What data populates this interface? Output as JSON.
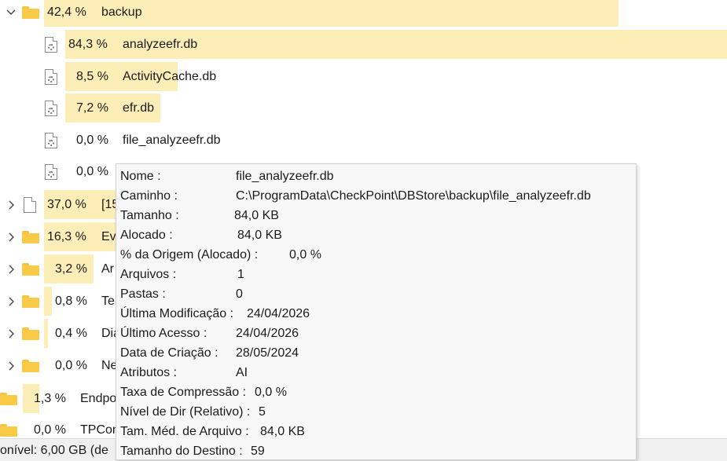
{
  "tree": {
    "backup": {
      "pct": "42,4 %",
      "name": "backup"
    },
    "files": [
      {
        "pct": "84,3 %",
        "name": "analyzeefr.db"
      },
      {
        "pct": "8,5 %",
        "name": "ActivityCache.db"
      },
      {
        "pct": "7,2 %",
        "name": "efr.db"
      },
      {
        "pct": "0,0 %",
        "name": "file_analyzeefr.db"
      },
      {
        "pct": "0,0 %",
        "name": ""
      }
    ],
    "siblings": [
      {
        "pct": "37,0 %",
        "name": "[15"
      },
      {
        "pct": "16,3 %",
        "name": "Ev"
      },
      {
        "pct": "3,2 %",
        "name": "Ar"
      },
      {
        "pct": "0,8 %",
        "name": "Ter"
      },
      {
        "pct": "0,4 %",
        "name": "Dia"
      },
      {
        "pct": "0,0 %",
        "name": "Ne"
      }
    ],
    "parents": [
      {
        "pct": "1,3 %",
        "name": "Endpo"
      },
      {
        "pct": "0,0 %",
        "name": "TPCon"
      }
    ]
  },
  "status": {
    "text": "onível: 6,00 GB  (de"
  },
  "tooltip": {
    "rows": [
      {
        "label": "Nome :",
        "value": "file_analyzeefr.db"
      },
      {
        "label": "Caminho :",
        "value": "C:\\ProgramData\\CheckPoint\\DBStore\\backup\\file_analyzeefr.db"
      },
      {
        "label": "Tamanho :",
        "value": "84,0 KB"
      },
      {
        "label": "Alocado :",
        "value": "84,0 KB"
      },
      {
        "label": "% da Origem (Alocado) :",
        "value": "0,0 %"
      },
      {
        "label": "Arquivos :",
        "value": "1"
      },
      {
        "label": "Pastas :",
        "value": "0"
      },
      {
        "label": "Última Modificação :",
        "value": "24/04/2026"
      },
      {
        "label": "Último Acesso :",
        "value": "24/04/2026"
      },
      {
        "label": "Data de Criação :",
        "value": "28/05/2024"
      },
      {
        "label": "Atributos :",
        "value": "AI"
      },
      {
        "label": "Taxa de Compressão :",
        "value": "0,0 %"
      },
      {
        "label": "Nível de Dir (Relativo) :",
        "value": "5"
      },
      {
        "label": "Tam. Méd. de Arquivo :",
        "value": "84,0 KB"
      },
      {
        "label": "Tamanho do Destino :",
        "value": "59"
      }
    ]
  },
  "colors": {
    "bar": "#fdeeb8",
    "folder": "#f9c948"
  }
}
